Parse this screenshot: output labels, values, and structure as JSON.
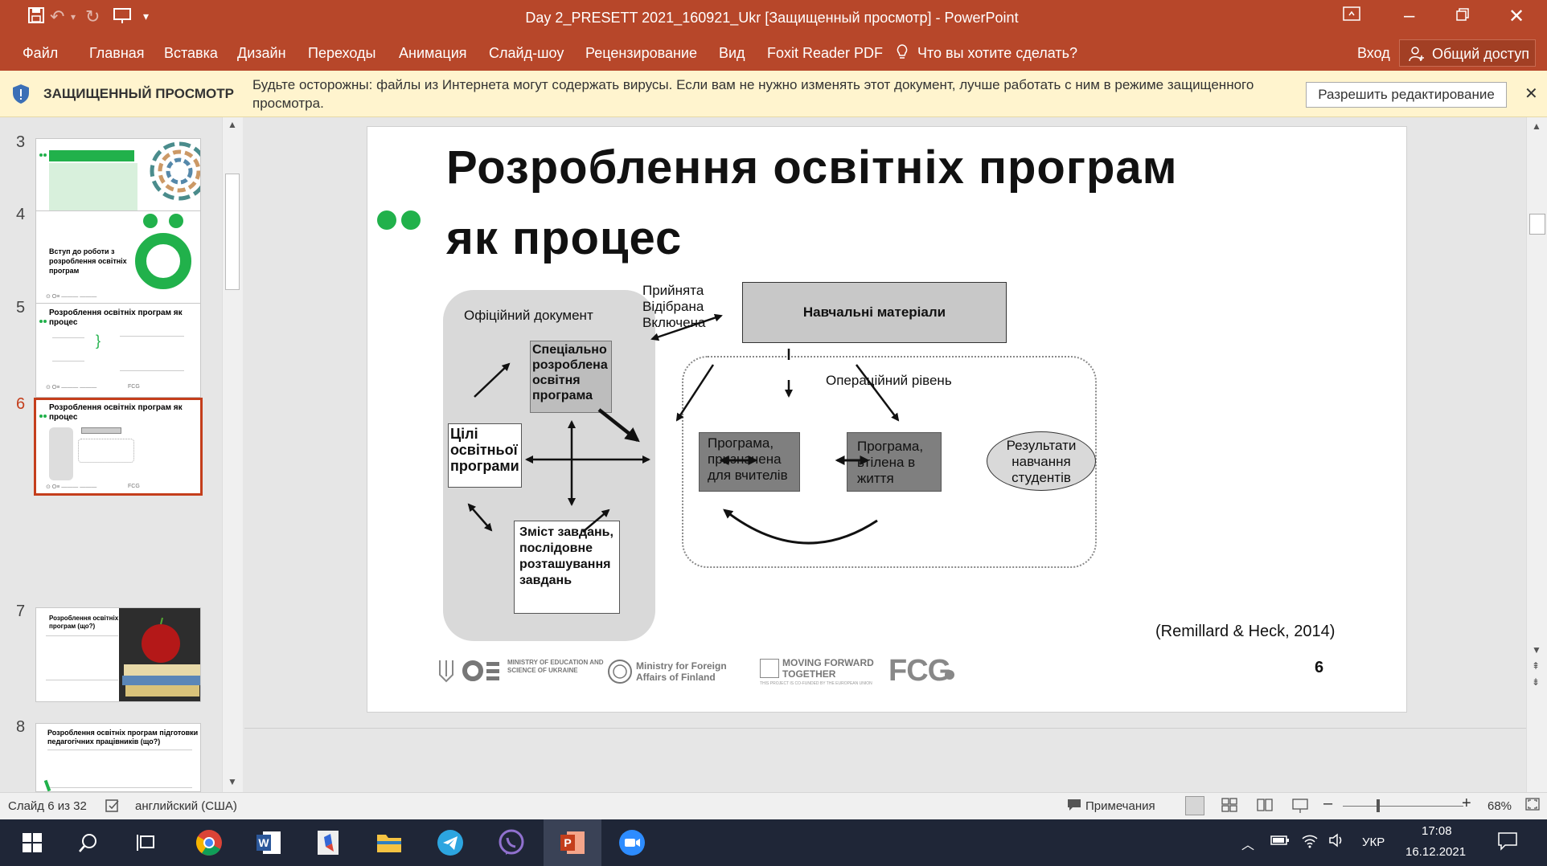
{
  "window": {
    "title": "Day 2_PRESETT 2021_160921_Ukr [Защищенный просмотр] - PowerPoint"
  },
  "ribbon": {
    "tabs": [
      "Файл",
      "Главная",
      "Вставка",
      "Дизайн",
      "Переходы",
      "Анимация",
      "Слайд-шоу",
      "Рецензирование",
      "Вид",
      "Foxit Reader PDF"
    ],
    "tell_me": "Что вы хотите сделать?",
    "signin": "Вход",
    "share": "Общий доступ"
  },
  "protected": {
    "label": "ЗАЩИЩЕННЫЙ ПРОСМОТР",
    "message": "Будьте осторожны: файлы из Интернета могут содержать вирусы. Если вам не нужно изменять этот документ, лучше работать с ним в режиме защищенного просмотра.",
    "enable_button": "Разрешить редактирование"
  },
  "thumbs": {
    "numbers": [
      "3",
      "4",
      "5",
      "6",
      "7",
      "8"
    ],
    "t4": "Вступ до роботи з розроблення освітніх програм",
    "t5": "Розроблення освітніх програм як процес",
    "t6": "Розроблення освітніх програм як процес",
    "t7": "Розроблення освітніх програм (що?)",
    "t8": "Розроблення освітніх програм підготовки педагогічних працівників (що?)",
    "fcg": "FCG"
  },
  "slide": {
    "title_line1": "Розроблення освітніх програм",
    "title_line2": "як процес",
    "official_doc": "Офіційний документ",
    "accepted": [
      "Прийнята",
      "Відібрана",
      "Включена"
    ],
    "materials": "Навчальні матеріали",
    "special": "Спеціально розроблена освітня програма",
    "goals": "Цілі освітньої програми",
    "content": "Зміст завдань, послідовне розташування завдань",
    "operational": "Операційний рівень",
    "teacher_program": "Програма, призначена для вчителів",
    "implemented": "Програма, втілена в життя",
    "results": "Результати навчання студентів",
    "citation": "(Remillard & Heck, 2014)",
    "page_number": "6",
    "logo_mon": "MINISTRY OF EDUCATION AND SCIENCE OF UKRAINE",
    "logo_mfa": "Ministry for Foreign Affairs of Finland",
    "logo_mft": "MOVING FORWARD TOGETHER",
    "logo_mft_sub": "THIS PROJECT IS CO-FUNDED BY THE EUROPEAN UNION",
    "logo_fcg": "FCG"
  },
  "status": {
    "slide_of": "Слайд 6 из 32",
    "language": "английский (США)",
    "notes": "Примечания",
    "zoom": "68%"
  },
  "taskbar": {
    "lang": "УКР",
    "time": "17:08",
    "date": "16.12.2021"
  }
}
